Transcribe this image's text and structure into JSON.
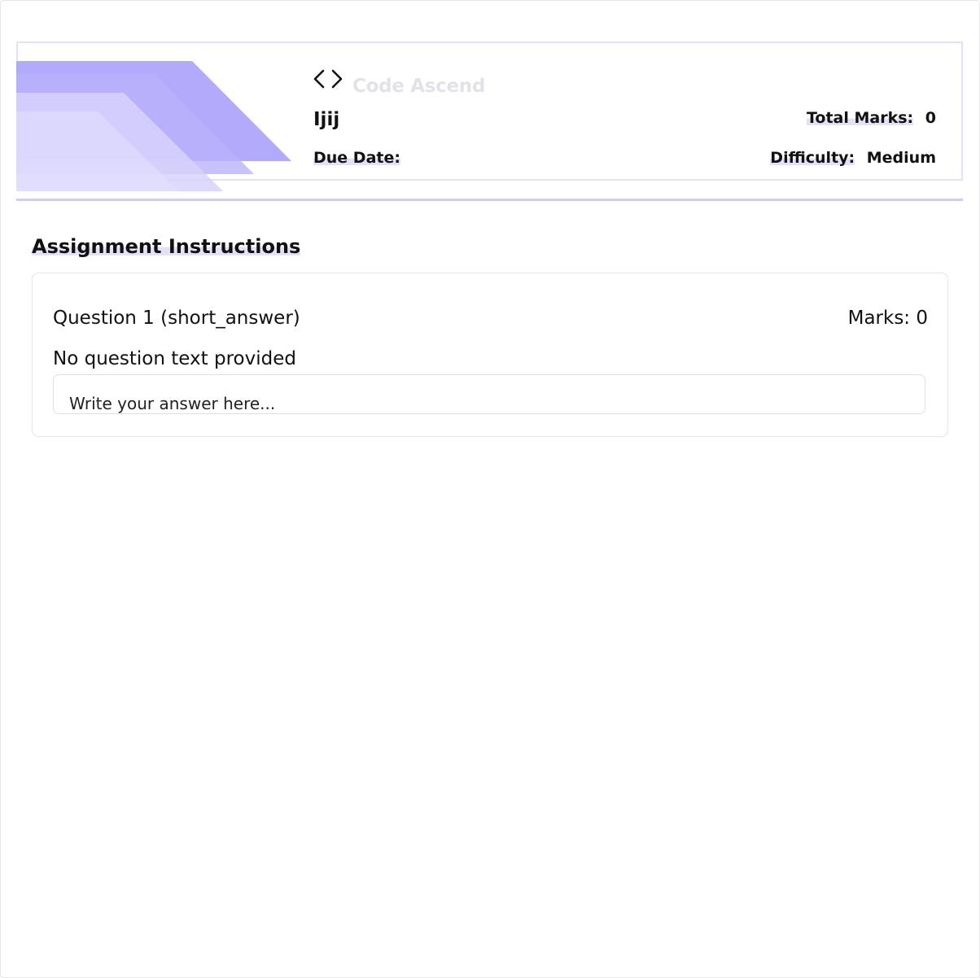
{
  "header": {
    "brand": "Code Ascend",
    "brand_icon": "code-brackets-icon",
    "assignment_title": "Ijij",
    "due_date_label": "Due Date:",
    "due_date_value": "",
    "total_marks_label": "Total Marks:",
    "total_marks_value": "0",
    "difficulty_label": "Difficulty:",
    "difficulty_value": "Medium",
    "accent_color": "#a49cfa"
  },
  "instructions": {
    "title": "Assignment Instructions"
  },
  "questions": [
    {
      "heading": "Question 1 (short_answer)",
      "marks_label": "Marks: 0",
      "text": "No question text provided",
      "answer_placeholder": "Write your answer here..."
    }
  ]
}
